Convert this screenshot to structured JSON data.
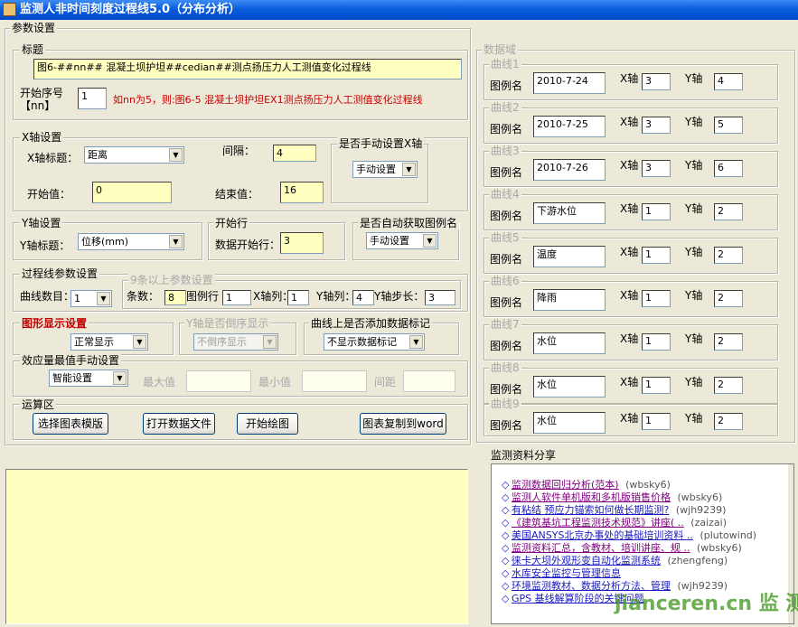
{
  "window": {
    "title": "监测人非时间刻度过程线5.0（分布分析）"
  },
  "params": {
    "legend": "参数设置",
    "title_group": {
      "legend": "标题",
      "value": "图6-##nn##  混凝土坝护坦##cedian##测点扬压力人工测值变化过程线"
    },
    "start_no": {
      "label1": "开始序号",
      "label2": "【nn】",
      "value": "1",
      "hint": "如nn为5，则:图6-5  混凝土坝护坦EX1测点扬压力人工测值变化过程线"
    },
    "xaxis": {
      "legend": "X轴设置",
      "title_label": "X轴标题：",
      "title_value": "距离",
      "interval_label": "间隔：",
      "interval_value": "4",
      "start_label": "开始值：",
      "start_value": "0",
      "end_label": "结束值：",
      "end_value": "16",
      "manual_legend": "是否手动设置X轴",
      "manual_value": "手动设置"
    },
    "yaxis": {
      "legend": "Y轴设置",
      "title_label": "Y轴标题：",
      "title_value": "位移(mm)"
    },
    "start_row": {
      "legend": "开始行",
      "label": "数据开始行：",
      "value": "3"
    },
    "auto_legend": {
      "legend": "是否自动获取图例名",
      "value": "手动设置"
    },
    "process": {
      "legend": "过程线参数设置",
      "count_label": "曲线数目：",
      "count_value": "1",
      "sub_legend": "9条以上参数设置",
      "bars_label": "条数：",
      "bars_value": "8",
      "legend_row_label": "图例行",
      "legend_row_value": "1",
      "xcol_label": "X轴列：",
      "xcol_value": "1",
      "ycol_label": "Y轴列：",
      "ycol_value": "4",
      "ystep_label": "Y轴步长：",
      "ystep_value": "3"
    },
    "display": {
      "legend": "图形显示设置",
      "value": "正常显示"
    },
    "yreverse": {
      "legend": "Y轴是否倒序显示",
      "value": "不倒序显示"
    },
    "datalabel": {
      "legend": "曲线上是否添加数据标记",
      "value": "不显示数据标记"
    },
    "extreme": {
      "legend": "效应量最值手动设置",
      "mode_value": "智能设置",
      "max_label": "最大值",
      "min_label": "最小值",
      "gap_label": "间距"
    },
    "ops": {
      "legend": "运算区",
      "buttons": [
        "选择图表模版",
        "打开数据文件",
        "开始绘图",
        "图表复制到word"
      ]
    }
  },
  "datadomain": {
    "legend": "数据域",
    "legend_name_label": "图例名",
    "x_label": "X轴",
    "y_label": "Y轴",
    "curves": [
      {
        "legend": "曲线1",
        "name": "2010-7-24",
        "x": "3",
        "y": "4"
      },
      {
        "legend": "曲线2",
        "name": "2010-7-25",
        "x": "3",
        "y": "5"
      },
      {
        "legend": "曲线3",
        "name": "2010-7-26",
        "x": "3",
        "y": "6"
      },
      {
        "legend": "曲线4",
        "name": "下游水位",
        "x": "1",
        "y": "2"
      },
      {
        "legend": "曲线5",
        "name": "温度",
        "x": "1",
        "y": "2"
      },
      {
        "legend": "曲线6",
        "name": "降雨",
        "x": "1",
        "y": "2"
      },
      {
        "legend": "曲线7",
        "name": "水位",
        "x": "1",
        "y": "2"
      },
      {
        "legend": "曲线8",
        "name": "水位",
        "x": "1",
        "y": "2"
      },
      {
        "legend": "曲线9",
        "name": "水位",
        "x": "1",
        "y": "2"
      }
    ]
  },
  "share": {
    "title": "监测资料分享",
    "items": [
      {
        "text": "监测数据回归分析(范本)",
        "author": "(wbsky6)",
        "visited": true
      },
      {
        "text": "监测人软件单机版和多机版销售价格",
        "author": "(wbsky6)",
        "visited": true
      },
      {
        "text": "有粘结 预应力锚索如何做长期监测?",
        "author": "(wjh9239)",
        "visited": false
      },
      {
        "text": "《建筑基坑工程监测技术规范》讲座( ..",
        "author": "(zaizai)",
        "visited": true
      },
      {
        "text": "美国ANSYS北京办事处的基础培训资料 ..",
        "author": "(plutowind)",
        "visited": false
      },
      {
        "text": "监测资料汇总，含教材、培训讲座、规 ..",
        "author": "(wbsky6)",
        "visited": true
      },
      {
        "text": "徕卡大坝外观形变自动化监测系统",
        "author": "(zhengfeng)",
        "visited": false
      },
      {
        "text": "水库安全监控与管理信息",
        "author": "",
        "visited": false
      },
      {
        "text": "环境监测教材、数据分析方法、管理",
        "author": "(wjh9239)",
        "visited": false
      },
      {
        "text": "GPS 基线解算阶段的关键问题",
        "author": "",
        "visited": false
      }
    ],
    "watermark": "jianceren.cn 监 测 人"
  }
}
